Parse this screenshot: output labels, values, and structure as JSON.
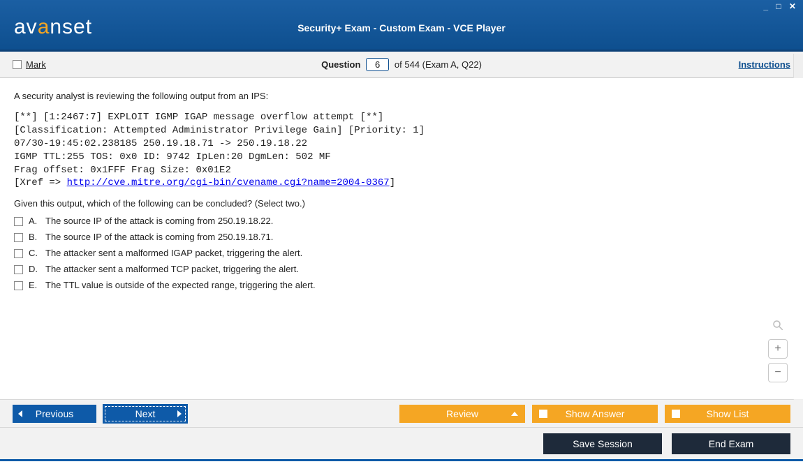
{
  "logo_text": "avanset",
  "window_title": "Security+ Exam - Custom Exam - VCE Player",
  "toolbar": {
    "mark_label": "Mark",
    "question_label": "Question",
    "question_number": "6",
    "question_suffix": "of 544 (Exam A, Q22)",
    "instructions": "Instructions"
  },
  "question": {
    "stem": "A security analyst is reviewing the following output from an IPS:",
    "mono_line1": "[**] [1:2467:7] EXPLOIT IGMP IGAP message overflow attempt [**]",
    "mono_line2": "[Classification: Attempted Administrator Privilege Gain] [Priority: 1]",
    "mono_line3": "07/30-19:45:02.238185 250.19.18.71 -> 250.19.18.22",
    "mono_line4": "IGMP TTL:255 TOS: 0x0 ID: 9742 IpLen:20 DgmLen: 502 MF",
    "mono_line5": "Frag offset: 0x1FFF Frag Size: 0x01E2",
    "mono_line6_pre": "[Xref => ",
    "mono_link": "http://cve.mitre.org/cgi-bin/cvename.cgi?name=2004-0367",
    "mono_line6_post": "]",
    "sub": "Given this output, which of the following can be concluded? (Select two.)",
    "options": [
      {
        "letter": "A.",
        "text": "The source IP of the attack is coming from 250.19.18.22."
      },
      {
        "letter": "B.",
        "text": "The source IP of the attack is coming from 250.19.18.71."
      },
      {
        "letter": "C.",
        "text": "The attacker sent a malformed IGAP packet, triggering the alert."
      },
      {
        "letter": "D.",
        "text": "The attacker sent a malformed TCP packet, triggering the alert."
      },
      {
        "letter": "E.",
        "text": "The TTL value is outside of the expected range, triggering the alert."
      }
    ]
  },
  "nav": {
    "previous": "Previous",
    "next": "Next",
    "review": "Review",
    "show_answer": "Show Answer",
    "show_list": "Show List"
  },
  "bottom": {
    "save_session": "Save Session",
    "end_exam": "End Exam"
  },
  "tools": {
    "plus": "+",
    "minus": "−"
  }
}
